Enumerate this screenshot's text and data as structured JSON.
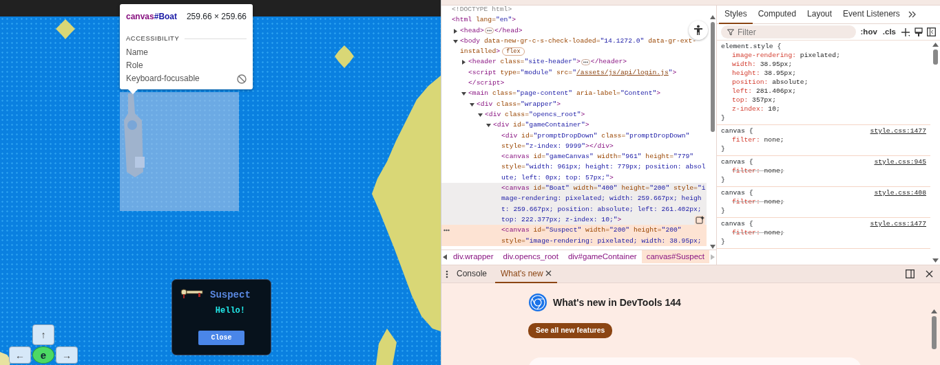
{
  "game": {
    "inspect_tooltip": {
      "tag": "canvas",
      "id": "#Boat",
      "size": "259.66 × 259.66",
      "section": "ACCESSIBILITY",
      "rows": [
        {
          "label": "Name"
        },
        {
          "label": "Role"
        },
        {
          "label": "Keyboard-focusable",
          "focusable": false
        }
      ]
    },
    "dialog": {
      "title": "Suspect",
      "message": "Hello!",
      "button": "Close"
    },
    "dpad": [
      {
        "label": "↑",
        "kind": "key"
      },
      {
        "label": "←",
        "kind": "key"
      },
      {
        "label": "e",
        "kind": "action"
      },
      {
        "label": "→",
        "kind": "key"
      }
    ]
  },
  "devtools": {
    "dom": [
      {
        "selected": false,
        "hovered": false,
        "lines": [
          [
            {
              "kind": "doctype",
              "text": "<!DOCTYPE html>"
            }
          ]
        ]
      },
      {
        "selected": false,
        "hovered": false,
        "lines": [
          [
            {
              "kind": "tag",
              "text": "<html"
            },
            {
              "kind": "attr",
              "text": " lang="
            },
            {
              "kind": "value",
              "text": "\"en\""
            },
            {
              "kind": "tag",
              "text": ">"
            }
          ]
        ],
        "children": [
          {
            "selected": false,
            "hovered": false,
            "expanded": false,
            "lines": [
              [
                {
                  "kind": "tag",
                  "text": "<head>"
                },
                {
                  "kind": "ellipsis"
                },
                {
                  "kind": "tag",
                  "text": "</head>"
                }
              ]
            ]
          },
          {
            "selected": false,
            "hovered": false,
            "expanded": true,
            "lines": [
              [
                {
                  "kind": "tag",
                  "text": "<body"
                },
                {
                  "kind": "attr",
                  "text": " data-new-gr-c-s-check-loaded="
                },
                {
                  "kind": "value",
                  "text": "\"14.1272.0\""
                },
                {
                  "kind": "attr",
                  "text": " data-gr-ext-"
                }
              ],
              [
                {
                  "kind": "attr",
                  "text": "installed"
                },
                {
                  "kind": "tag",
                  "text": ">"
                },
                {
                  "kind": "badge",
                  "text": "flex"
                }
              ]
            ],
            "children": [
              {
                "selected": false,
                "hovered": false,
                "expanded": false,
                "lines": [
                  [
                    {
                      "kind": "tag",
                      "text": "<header"
                    },
                    {
                      "kind": "attr",
                      "text": " class="
                    },
                    {
                      "kind": "value",
                      "text": "\"site-header\""
                    },
                    {
                      "kind": "tag",
                      "text": ">"
                    },
                    {
                      "kind": "ellipsis"
                    },
                    {
                      "kind": "tag",
                      "text": "</header>"
                    }
                  ]
                ]
              },
              {
                "selected": false,
                "hovered": false,
                "lines": [
                  [
                    {
                      "kind": "tag",
                      "text": "<script"
                    },
                    {
                      "kind": "attr",
                      "text": " type="
                    },
                    {
                      "kind": "value",
                      "text": "\"module\""
                    },
                    {
                      "kind": "attr",
                      "text": " src="
                    },
                    {
                      "kind": "value",
                      "text": "\""
                    },
                    {
                      "kind": "link",
                      "text": "/assets/js/api/login.js"
                    },
                    {
                      "kind": "value",
                      "text": "\""
                    },
                    {
                      "kind": "tag",
                      "text": ">"
                    }
                  ],
                  [
                    {
                      "kind": "tag",
                      "text": "</script>"
                    }
                  ]
                ]
              },
              {
                "selected": false,
                "hovered": false,
                "expanded": true,
                "lines": [
                  [
                    {
                      "kind": "tag",
                      "text": "<main"
                    },
                    {
                      "kind": "attr",
                      "text": " class="
                    },
                    {
                      "kind": "value",
                      "text": "\"page-content\""
                    },
                    {
                      "kind": "attr",
                      "text": " aria-label="
                    },
                    {
                      "kind": "value",
                      "text": "\"Content\""
                    },
                    {
                      "kind": "tag",
                      "text": ">"
                    }
                  ]
                ],
                "children": [
                  {
                    "selected": false,
                    "hovered": false,
                    "expanded": true,
                    "lines": [
                      [
                        {
                          "kind": "tag",
                          "text": "<div"
                        },
                        {
                          "kind": "attr",
                          "text": " class="
                        },
                        {
                          "kind": "value",
                          "text": "\"wrapper\""
                        },
                        {
                          "kind": "tag",
                          "text": ">"
                        }
                      ]
                    ],
                    "children": [
                      {
                        "selected": false,
                        "hovered": false,
                        "expanded": true,
                        "lines": [
                          [
                            {
                              "kind": "tag",
                              "text": "<div"
                            },
                            {
                              "kind": "attr",
                              "text": " class="
                            },
                            {
                              "kind": "value",
                              "text": "\"opencs_root\""
                            },
                            {
                              "kind": "tag",
                              "text": ">"
                            }
                          ]
                        ],
                        "children": [
                          {
                            "selected": false,
                            "hovered": false,
                            "expanded": true,
                            "lines": [
                              [
                                {
                                  "kind": "tag",
                                  "text": "<div"
                                },
                                {
                                  "kind": "attr",
                                  "text": " id="
                                },
                                {
                                  "kind": "value",
                                  "text": "\"gameContainer\""
                                },
                                {
                                  "kind": "tag",
                                  "text": ">"
                                }
                              ]
                            ],
                            "children": [
                              {
                                "selected": false,
                                "hovered": false,
                                "lines": [
                                  [
                                    {
                                      "kind": "tag",
                                      "text": "<div"
                                    },
                                    {
                                      "kind": "attr",
                                      "text": " id="
                                    },
                                    {
                                      "kind": "value",
                                      "text": "\"promptDropDown\""
                                    },
                                    {
                                      "kind": "attr",
                                      "text": " class="
                                    },
                                    {
                                      "kind": "value",
                                      "text": "\"promptDropDown\""
                                    }
                                  ],
                                  [
                                    {
                                      "kind": "attr",
                                      "text": "style="
                                    },
                                    {
                                      "kind": "value",
                                      "text": "\"z-index: 9999\""
                                    },
                                    {
                                      "kind": "tag",
                                      "text": "></div>"
                                    }
                                  ]
                                ]
                              },
                              {
                                "selected": false,
                                "hovered": false,
                                "lines": [
                                  [
                                    {
                                      "kind": "tag",
                                      "text": "<canvas"
                                    },
                                    {
                                      "kind": "attr",
                                      "text": " id="
                                    },
                                    {
                                      "kind": "value",
                                      "text": "\"gameCanvas\""
                                    },
                                    {
                                      "kind": "attr",
                                      "text": " width="
                                    },
                                    {
                                      "kind": "value",
                                      "text": "\"961\""
                                    },
                                    {
                                      "kind": "attr",
                                      "text": " height="
                                    },
                                    {
                                      "kind": "value",
                                      "text": "\"779\""
                                    }
                                  ],
                                  [
                                    {
                                      "kind": "attr",
                                      "text": "style="
                                    },
                                    {
                                      "kind": "value",
                                      "text": "\"width: 961px; height: 779px; position: absol"
                                    }
                                  ],
                                  [
                                    {
                                      "kind": "value",
                                      "text": "ute; left: 0px; top: 57px;\""
                                    },
                                    {
                                      "kind": "tag",
                                      "text": ">"
                                    }
                                  ]
                                ]
                              },
                              {
                                "selected": false,
                                "hovered": true,
                                "lines": [
                                  [
                                    {
                                      "kind": "tag",
                                      "text": "<canvas"
                                    },
                                    {
                                      "kind": "attr",
                                      "text": " id="
                                    },
                                    {
                                      "kind": "value",
                                      "text": "\"Boat\""
                                    },
                                    {
                                      "kind": "attr",
                                      "text": " width="
                                    },
                                    {
                                      "kind": "value",
                                      "text": "\"400\""
                                    },
                                    {
                                      "kind": "attr",
                                      "text": " height="
                                    },
                                    {
                                      "kind": "value",
                                      "text": "\"200\""
                                    },
                                    {
                                      "kind": "attr",
                                      "text": " style="
                                    },
                                    {
                                      "kind": "value",
                                      "text": "\"i"
                                    }
                                  ],
                                  [
                                    {
                                      "kind": "value",
                                      "text": "mage-rendering: pixelated; width: 259.667px; heigh"
                                    }
                                  ],
                                  [
                                    {
                                      "kind": "value",
                                      "text": "t: 259.667px; position: absolute; left: 261.402px;"
                                    }
                                  ],
                                  [
                                    {
                                      "kind": "value",
                                      "text": "top: 222.377px; z-index: 10;\""
                                    },
                                    {
                                      "kind": "tag",
                                      "text": ">"
                                    }
                                  ]
                                ]
                              },
                              {
                                "selected": true,
                                "hovered": false,
                                "lines": [
                                  [
                                    {
                                      "kind": "tag",
                                      "text": "<canvas"
                                    },
                                    {
                                      "kind": "attr",
                                      "text": " id="
                                    },
                                    {
                                      "kind": "value",
                                      "text": "\"Suspect\""
                                    },
                                    {
                                      "kind": "attr",
                                      "text": " width="
                                    },
                                    {
                                      "kind": "value",
                                      "text": "\"200\""
                                    },
                                    {
                                      "kind": "attr",
                                      "text": " height="
                                    },
                                    {
                                      "kind": "value",
                                      "text": "\"200\""
                                    }
                                  ],
                                  [
                                    {
                                      "kind": "attr",
                                      "text": "style="
                                    },
                                    {
                                      "kind": "value",
                                      "text": "\"image-rendering: pixelated; width: 38.95px;"
                                    }
                                  ]
                                ]
                              }
                            ]
                          }
                        ]
                      }
                    ]
                  }
                ]
              }
            ]
          }
        ]
      }
    ],
    "breadcrumbs": [
      {
        "label": "div.wrapper",
        "selected": false
      },
      {
        "label": "div.opencs_root",
        "selected": false
      },
      {
        "label": "div#gameContainer",
        "selected": false
      },
      {
        "label": "canvas#Suspect",
        "selected": true
      }
    ],
    "styles_tabs": [
      {
        "label": "Styles",
        "selected": true
      },
      {
        "label": "Computed",
        "selected": false
      },
      {
        "label": "Layout",
        "selected": false
      },
      {
        "label": "Event Listeners",
        "selected": false
      }
    ],
    "filter": {
      "placeholder": "Filter"
    },
    "toolbar": [
      ":hov",
      ".cls"
    ],
    "rules": [
      {
        "selector": "element.style {",
        "end": "}",
        "declarations": [
          {
            "property": "image-rendering:",
            "value": " pixelated;",
            "struck": false
          },
          {
            "property": "width:",
            "value": " 38.95px;",
            "struck": false
          },
          {
            "property": "height:",
            "value": " 38.95px;",
            "struck": false
          },
          {
            "property": "position:",
            "value": " absolute;",
            "struck": false
          },
          {
            "property": "left:",
            "value": " 281.406px;",
            "struck": false
          },
          {
            "property": "top:",
            "value": " 357px;",
            "struck": false
          },
          {
            "property": "z-index:",
            "value": " 10;",
            "struck": false
          }
        ]
      },
      {
        "selector": "canvas {",
        "source": "style.css:1477",
        "end": "}",
        "declarations": [
          {
            "property": "filter:",
            "value": " none;",
            "struck": false
          }
        ]
      },
      {
        "selector": "canvas {",
        "source": "style.css:945",
        "end": "}",
        "declarations": [
          {
            "property": "filter:",
            "value": " none;",
            "struck": true
          }
        ]
      },
      {
        "selector": "canvas {",
        "source": "style.css:408",
        "end": "}",
        "declarations": [
          {
            "property": "filter:",
            "value": " none;",
            "struck": true
          }
        ]
      },
      {
        "selector": "canvas {",
        "source": "style.css:1477",
        "end": "}",
        "declarations": [
          {
            "property": "filter:",
            "value": " none;",
            "struck": true
          }
        ]
      }
    ],
    "drawer": {
      "tabs": [
        {
          "label": "Console",
          "selected": false,
          "closable": false
        },
        {
          "label": "What's new",
          "selected": true,
          "closable": true
        }
      ],
      "heading": "What's new in DevTools 144",
      "button": "See all new features"
    }
  }
}
